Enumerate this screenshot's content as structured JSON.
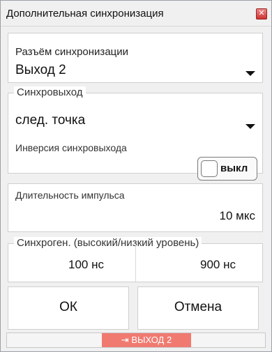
{
  "window": {
    "title": "Дополнительная синхронизация"
  },
  "sync_connector": {
    "label": "Разъём синхронизации",
    "value": "Выход 2"
  },
  "sync_output": {
    "legend": "Синхровыход",
    "value": "след. точка",
    "inversion_label": "Инверсия синхровыхода",
    "inversion_state": "выкл"
  },
  "pulse_duration": {
    "label": "Длительность импульса",
    "value": "10 мкс"
  },
  "sync_gen": {
    "legend": "Синхроген. (высокий/низкий уровень)",
    "high": "100 нс",
    "low": "900 нс"
  },
  "buttons": {
    "ok": "ОК",
    "cancel": "Отмена"
  },
  "status": {
    "icon": "output-arrow-icon",
    "text": "ВЫХОД 2",
    "color": "#f07a70"
  }
}
